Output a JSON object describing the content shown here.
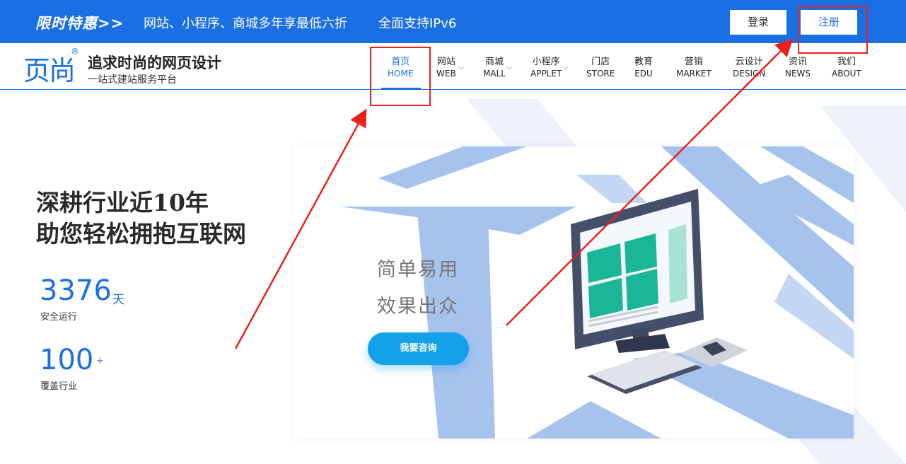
{
  "promo": {
    "tag": "限时特惠>>",
    "text": "网站、小程序、商城多年享最低六折",
    "text2": "全面支持IPv6",
    "login": "登录",
    "register": "注册"
  },
  "brand": {
    "logo": "页尚",
    "reg": "®",
    "slogan": "追求时尚的网页设计",
    "subslogan": "一站式建站服务平台"
  },
  "nav": [
    {
      "cn": "首页",
      "en": "HOME"
    },
    {
      "cn": "网站",
      "en": "WEB"
    },
    {
      "cn": "商城",
      "en": "MALL"
    },
    {
      "cn": "小程序",
      "en": "APPLET"
    },
    {
      "cn": "门店",
      "en": "STORE"
    },
    {
      "cn": "教育",
      "en": "EDU"
    },
    {
      "cn": "营销",
      "en": "MARKET"
    },
    {
      "cn": "云设计",
      "en": "DESIGN"
    },
    {
      "cn": "资讯",
      "en": "NEWS"
    },
    {
      "cn": "我们",
      "en": "ABOUT"
    }
  ],
  "hero": {
    "line1": "深耕行业近10年",
    "line2": "助您轻松拥抱互联网"
  },
  "stats": [
    {
      "num": "3376",
      "unit": "天",
      "label": "安全运行"
    },
    {
      "num": "100",
      "unit": "+",
      "label": "覆盖行业"
    }
  ],
  "card": {
    "line1": "简单易用",
    "line2": "效果出众",
    "cta": "我要咨询"
  },
  "colors": {
    "brand_blue": "#1a6fe3",
    "cta_blue": "#13a1ea",
    "annotation_red": "#e8211d"
  }
}
